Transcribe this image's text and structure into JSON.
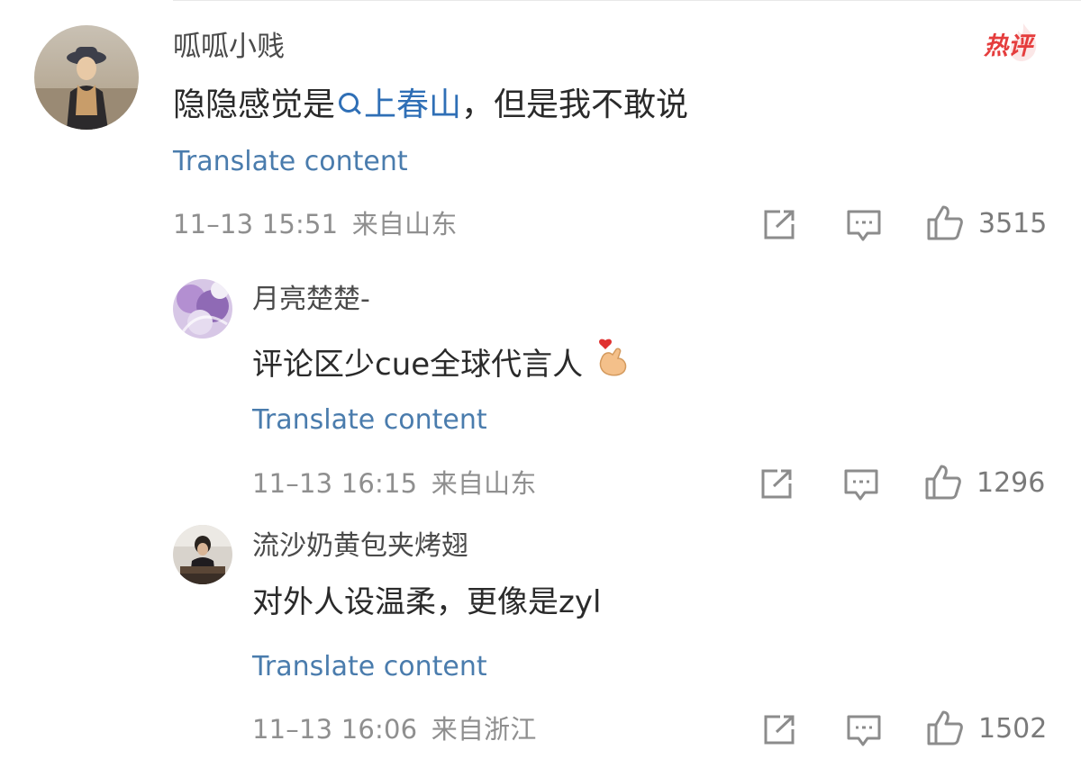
{
  "comment": {
    "username": "呱呱小贱",
    "badge": "热评",
    "text_prefix": "隐隐感觉是",
    "topic": "上春山",
    "text_suffix": "，但是我不敢说",
    "translate": "Translate content",
    "timestamp": "11–13 15:51",
    "location": "来自山东",
    "likes": "3515"
  },
  "replies": [
    {
      "username": "月亮楚楚-",
      "text": "评论区少cue全球代言人",
      "emoji": "🫰",
      "translate": "Translate content",
      "timestamp": "11–13 16:15",
      "location": "来自山东",
      "likes": "1296"
    },
    {
      "username": "流沙奶黄包夹烤翅",
      "text": "对外人设温柔，更像是zyl",
      "translate": "Translate content",
      "timestamp": "11–13 16:06",
      "location": "来自浙江",
      "likes": "1502"
    }
  ],
  "icons": {
    "share": "share-icon",
    "comment": "comment-icon",
    "like": "like-icon"
  },
  "colors": {
    "link": "#4a7cad",
    "topic": "#2f6fb6",
    "badge": "#e53d3d",
    "meta": "#8f8f8f"
  }
}
